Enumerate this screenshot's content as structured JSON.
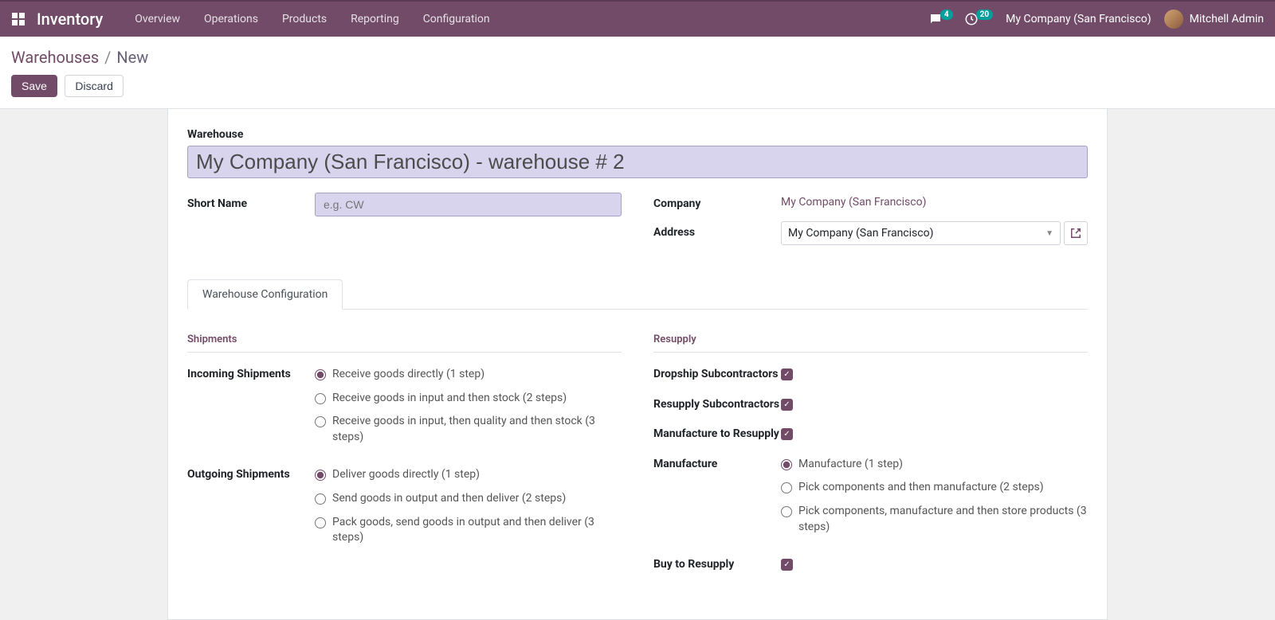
{
  "topbar": {
    "brand": "Inventory",
    "nav": [
      "Overview",
      "Operations",
      "Products",
      "Reporting",
      "Configuration"
    ],
    "messages_badge": "4",
    "activities_badge": "20",
    "company": "My Company (San Francisco)",
    "user": "Mitchell Admin"
  },
  "breadcrumb": {
    "parent": "Warehouses",
    "current": "New"
  },
  "buttons": {
    "save": "Save",
    "discard": "Discard"
  },
  "form": {
    "title_label": "Warehouse",
    "name_value": "My Company (San Francisco) - warehouse # 2",
    "short_name_label": "Short Name",
    "short_name_placeholder": "e.g. CW",
    "company_label": "Company",
    "company_value": "My Company (San Francisco)",
    "address_label": "Address",
    "address_value": "My Company (San Francisco)"
  },
  "tabs": {
    "config": "Warehouse Configuration"
  },
  "sections": {
    "shipments": "Shipments",
    "resupply": "Resupply"
  },
  "shipments": {
    "incoming_label": "Incoming Shipments",
    "incoming_opt1": "Receive goods directly (1 step)",
    "incoming_opt2": "Receive goods in input and then stock (2 steps)",
    "incoming_opt3": "Receive goods in input, then quality and then stock (3 steps)",
    "outgoing_label": "Outgoing Shipments",
    "outgoing_opt1": "Deliver goods directly (1 step)",
    "outgoing_opt2": "Send goods in output and then deliver (2 steps)",
    "outgoing_opt3": "Pack goods, send goods in output and then deliver (3 steps)"
  },
  "resupply": {
    "dropship_label": "Dropship Subcontractors",
    "resupply_sub_label": "Resupply Subcontractors",
    "mfg_resupply_label": "Manufacture to Resupply",
    "manufacture_label": "Manufacture",
    "mfg_opt1": "Manufacture (1 step)",
    "mfg_opt2": "Pick components and then manufacture (2 steps)",
    "mfg_opt3": "Pick components, manufacture and then store products (3 steps)",
    "buy_label": "Buy to Resupply"
  }
}
